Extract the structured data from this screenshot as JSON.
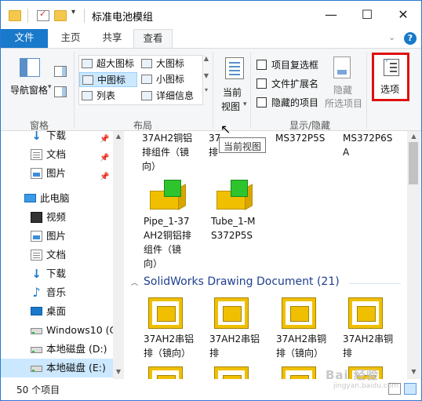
{
  "window": {
    "title": "标准电池模组",
    "controls": {
      "minimize": "—",
      "maximize": "☐",
      "close": "✕"
    }
  },
  "tabs": [
    {
      "label": "文件"
    },
    {
      "label": "主页"
    },
    {
      "label": "共享"
    },
    {
      "label": "查看",
      "active": true
    }
  ],
  "ribbon": {
    "panes": {
      "nav_pane_label": "导航窗格",
      "group_label": "窗格"
    },
    "layout": {
      "items": [
        "超大图标",
        "大图标",
        "中图标",
        "小图标",
        "列表",
        "详细信息"
      ],
      "selected": "中图标",
      "group_label": "布局"
    },
    "current_view": {
      "label_line1": "当前",
      "label_line2": "视图"
    },
    "show_hide": {
      "checkboxes": [
        "项目复选框",
        "文件扩展名",
        "隐藏的项目"
      ],
      "hide_label_line1": "隐藏",
      "hide_label_line2": "所选项目",
      "group_label": "显示/隐藏"
    },
    "options": {
      "label": "选项"
    }
  },
  "tooltip": "当前视图",
  "nav_pane": {
    "items": [
      {
        "label": "下载",
        "icon": "download-icon",
        "pinned": true
      },
      {
        "label": "文档",
        "icon": "document-icon",
        "pinned": true
      },
      {
        "label": "图片",
        "icon": "picture-icon",
        "pinned": true
      },
      {
        "label": "此电脑",
        "icon": "pc-icon"
      },
      {
        "label": "视频",
        "icon": "video-icon"
      },
      {
        "label": "图片",
        "icon": "picture-icon"
      },
      {
        "label": "文档",
        "icon": "document-icon"
      },
      {
        "label": "下载",
        "icon": "download-icon"
      },
      {
        "label": "音乐",
        "icon": "music-icon"
      },
      {
        "label": "桌面",
        "icon": "desktop-icon"
      },
      {
        "label": "Windows10 (C",
        "icon": "drive-icon"
      },
      {
        "label": "本地磁盘 (D:)",
        "icon": "drive-icon"
      },
      {
        "label": "本地磁盘 (E:)",
        "icon": "drive-icon",
        "selected": true
      }
    ]
  },
  "content": {
    "top_partial": {
      "col1_line1": "37AH2铜铝",
      "col1_line2": "排组件（镜",
      "col1_line3": "向）",
      "col2_line1": "37",
      "col2_line2": "排",
      "col3_line1": "MS372P5S",
      "col4_line1": "MS372P6S",
      "col4_line2": "A"
    },
    "parts": [
      {
        "line1": "Pipe_1-37",
        "line2": "AH2铜铝排",
        "line3": "组件（镜",
        "line4": "向）"
      },
      {
        "line1": "Tube_1-M",
        "line2": "S372P5S"
      }
    ],
    "group_header": "SolidWorks Drawing Document (21)",
    "drawings": [
      {
        "line1": "37AH2串铝",
        "line2": "排（镜向）"
      },
      {
        "line1": "37AH2串铝",
        "line2": "排"
      },
      {
        "line1": "37AH2串铜",
        "line2": "排（镜向）"
      },
      {
        "line1": "37AH2串铜",
        "line2": "排"
      }
    ]
  },
  "status": {
    "count": "50 个项目"
  },
  "watermark": {
    "main": "Bai 经验",
    "sub": "jingyan.baidu.com"
  }
}
